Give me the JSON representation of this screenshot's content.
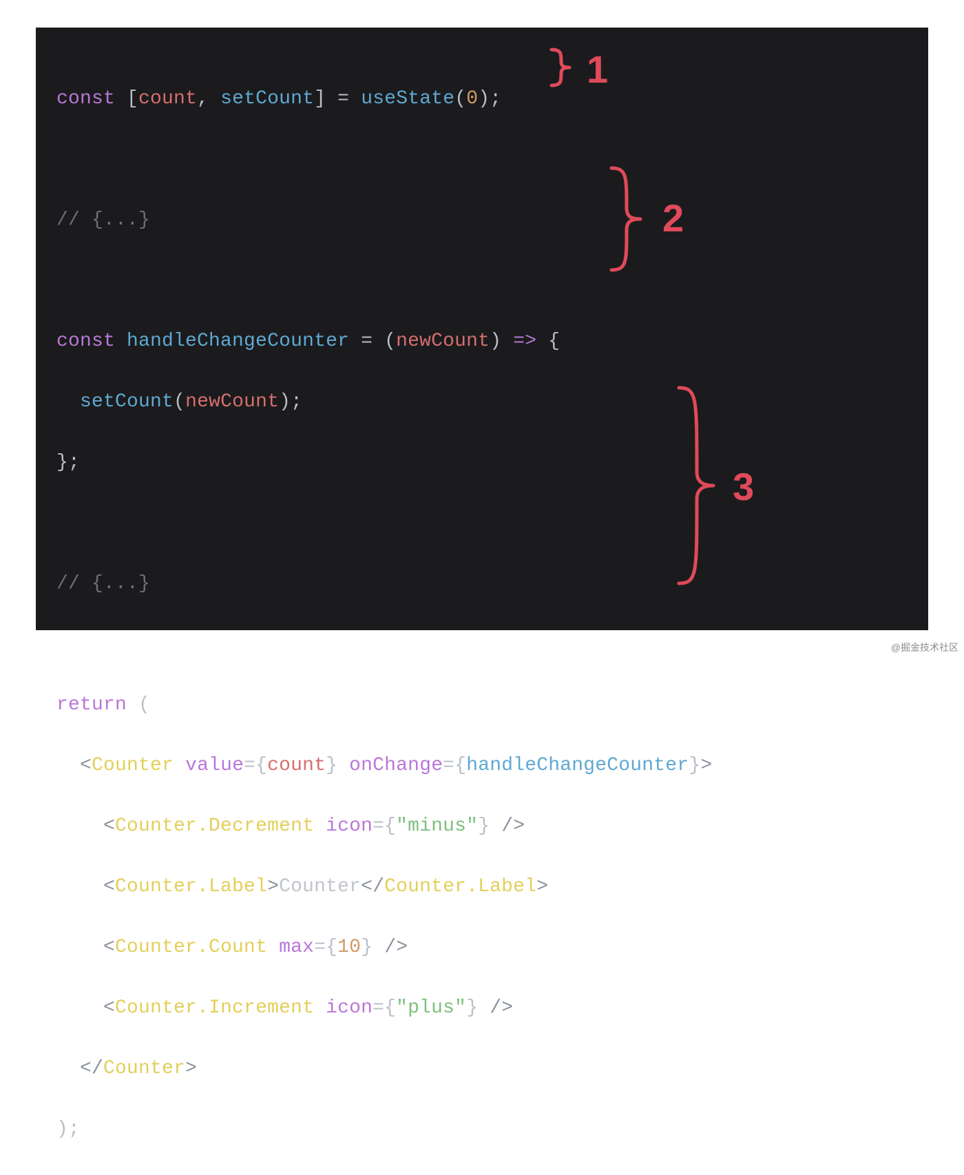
{
  "colors": {
    "bg": "#1b1b1d",
    "keyword": "#b877d8",
    "function": "#5fa8d3",
    "variable": "#d66e6e",
    "punct": "#b9bfc8",
    "number": "#d19a66",
    "comment": "#6d7079",
    "tag": "#e3cf5a",
    "angle": "#88909c",
    "attr": "#b877d8",
    "string": "#7fbf7f",
    "text": "#c0c4cc",
    "accent": "#e04a5a"
  },
  "annotations": {
    "n1": "1",
    "n2": "2",
    "n3": "3"
  },
  "watermark": "@掘金技术社区",
  "code": {
    "l1": {
      "const": "const",
      "lbr": "[",
      "count": "count",
      "comma": ",",
      "setCount": "setCount",
      "rbr": "]",
      "eq": "=",
      "useState": "useState",
      "lp": "(",
      "zero": "0",
      "rp": ")",
      "semi": ";"
    },
    "l3": {
      "cmt": "// {...}"
    },
    "l5": {
      "const": "const",
      "name": "handleChangeCounter",
      "eq": "=",
      "lp": "(",
      "param": "newCount",
      "rp": ")",
      "arrow": "=>",
      "lcb": "{"
    },
    "l6": {
      "indent": "  ",
      "fn": "setCount",
      "lp": "(",
      "arg": "newCount",
      "rp": ")",
      "semi": ";"
    },
    "l7": {
      "rcb": "}",
      "semi": ";"
    },
    "l9": {
      "cmt": "// {...}"
    },
    "l11": {
      "return": "return",
      "lp": "("
    },
    "l12": {
      "indent": "  ",
      "lt": "<",
      "tag": "Counter",
      "sp": " ",
      "attr1": "value",
      "eq1": "=",
      "lcb1": "{",
      "val1": "count",
      "rcb1": "}",
      "attr2": "onChange",
      "eq2": "=",
      "lcb2": "{",
      "val2": "handleChangeCounter",
      "rcb2": "}",
      "gt": ">"
    },
    "l13": {
      "indent": "    ",
      "lt": "<",
      "tag": "Counter.Decrement",
      "sp": " ",
      "attr": "icon",
      "eq": "=",
      "lcb": "{",
      "q1": "\"",
      "str": "minus",
      "q2": "\"",
      "rcb": "}",
      "sp2": " ",
      "slash": "/",
      "gt": ">"
    },
    "l14": {
      "indent": "    ",
      "lt": "<",
      "tag": "Counter.Label",
      "gt": ">",
      "txt": "Counter",
      "lt2": "<",
      "slash": "/",
      "tag2": "Counter.Label",
      "gt2": ">"
    },
    "l15": {
      "indent": "    ",
      "lt": "<",
      "tag": "Counter.Count",
      "sp": " ",
      "attr": "max",
      "eq": "=",
      "lcb": "{",
      "num": "10",
      "rcb": "}",
      "sp2": " ",
      "slash": "/",
      "gt": ">"
    },
    "l16": {
      "indent": "    ",
      "lt": "<",
      "tag": "Counter.Increment",
      "sp": " ",
      "attr": "icon",
      "eq": "=",
      "lcb": "{",
      "q1": "\"",
      "str": "plus",
      "q2": "\"",
      "rcb": "}",
      "sp2": " ",
      "slash": "/",
      "gt": ">"
    },
    "l17": {
      "indent": "  ",
      "lt": "<",
      "slash": "/",
      "tag": "Counter",
      "gt": ">"
    },
    "l18": {
      "rp": ")",
      "semi": ";"
    }
  }
}
